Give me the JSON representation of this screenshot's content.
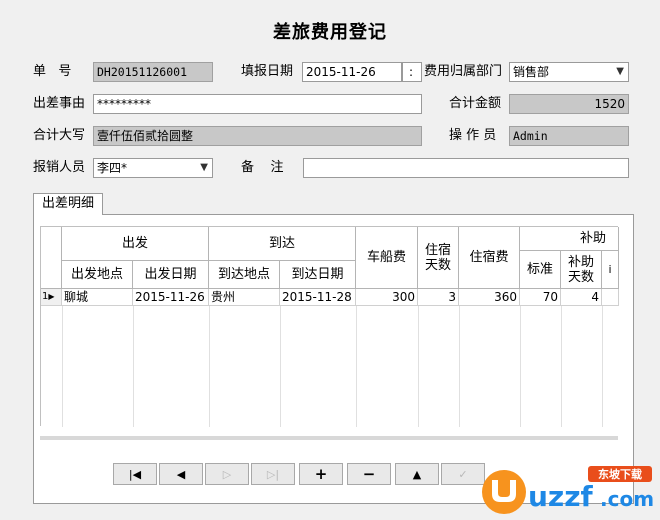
{
  "form": {
    "title": "差旅费用登记",
    "doc_no_label": "单   号",
    "doc_no": "DH20151126001",
    "fill_date_label": "填报日期",
    "fill_date": "2015-11-26",
    "fill_date_spin": ":",
    "dept_label": "费用归属部门",
    "dept": "销售部",
    "reason_label": "出差事由",
    "reason": "*********",
    "total_label": "合计金额",
    "total": "1520",
    "total_caps_label": "合计大写",
    "total_caps": "壹仟伍佰贰拾圆整",
    "operator_label": "操 作 员",
    "operator": "Admin",
    "claimant_label": "报销人员",
    "claimant": "李四*",
    "remark_label": "备    注",
    "remark": ""
  },
  "tab": {
    "label": "出差明细"
  },
  "table": {
    "group_depart": "出发",
    "group_arrive": "到达",
    "group_subsidy": "补助",
    "col_depart_place": "出发地点",
    "col_depart_date": "出发日期",
    "col_arrive_place": "到达地点",
    "col_arrive_date": "到达日期",
    "col_fare": "车船费",
    "col_nights": "住宿天数",
    "col_lodging": "住宿费",
    "col_standard": "标准",
    "col_subsidy_days": "补助天数",
    "rows": [
      {
        "num": "1",
        "depart_place": "聊城",
        "depart_date": "2015-11-26",
        "arrive_place": "贵州",
        "arrive_date": "2015-11-28",
        "fare": "300",
        "nights": "3",
        "lodging": "360",
        "standard": "70",
        "subsidy_days": "4"
      }
    ]
  },
  "nav": {
    "first": "first-record",
    "prior": "prior-record",
    "next": "next-record",
    "last": "last-record",
    "insert": "insert-record",
    "delete": "delete-record",
    "edit": "edit-record",
    "post": "post-record"
  },
  "watermark": {
    "text": "uzzf.com",
    "badge": "东坡下载"
  }
}
